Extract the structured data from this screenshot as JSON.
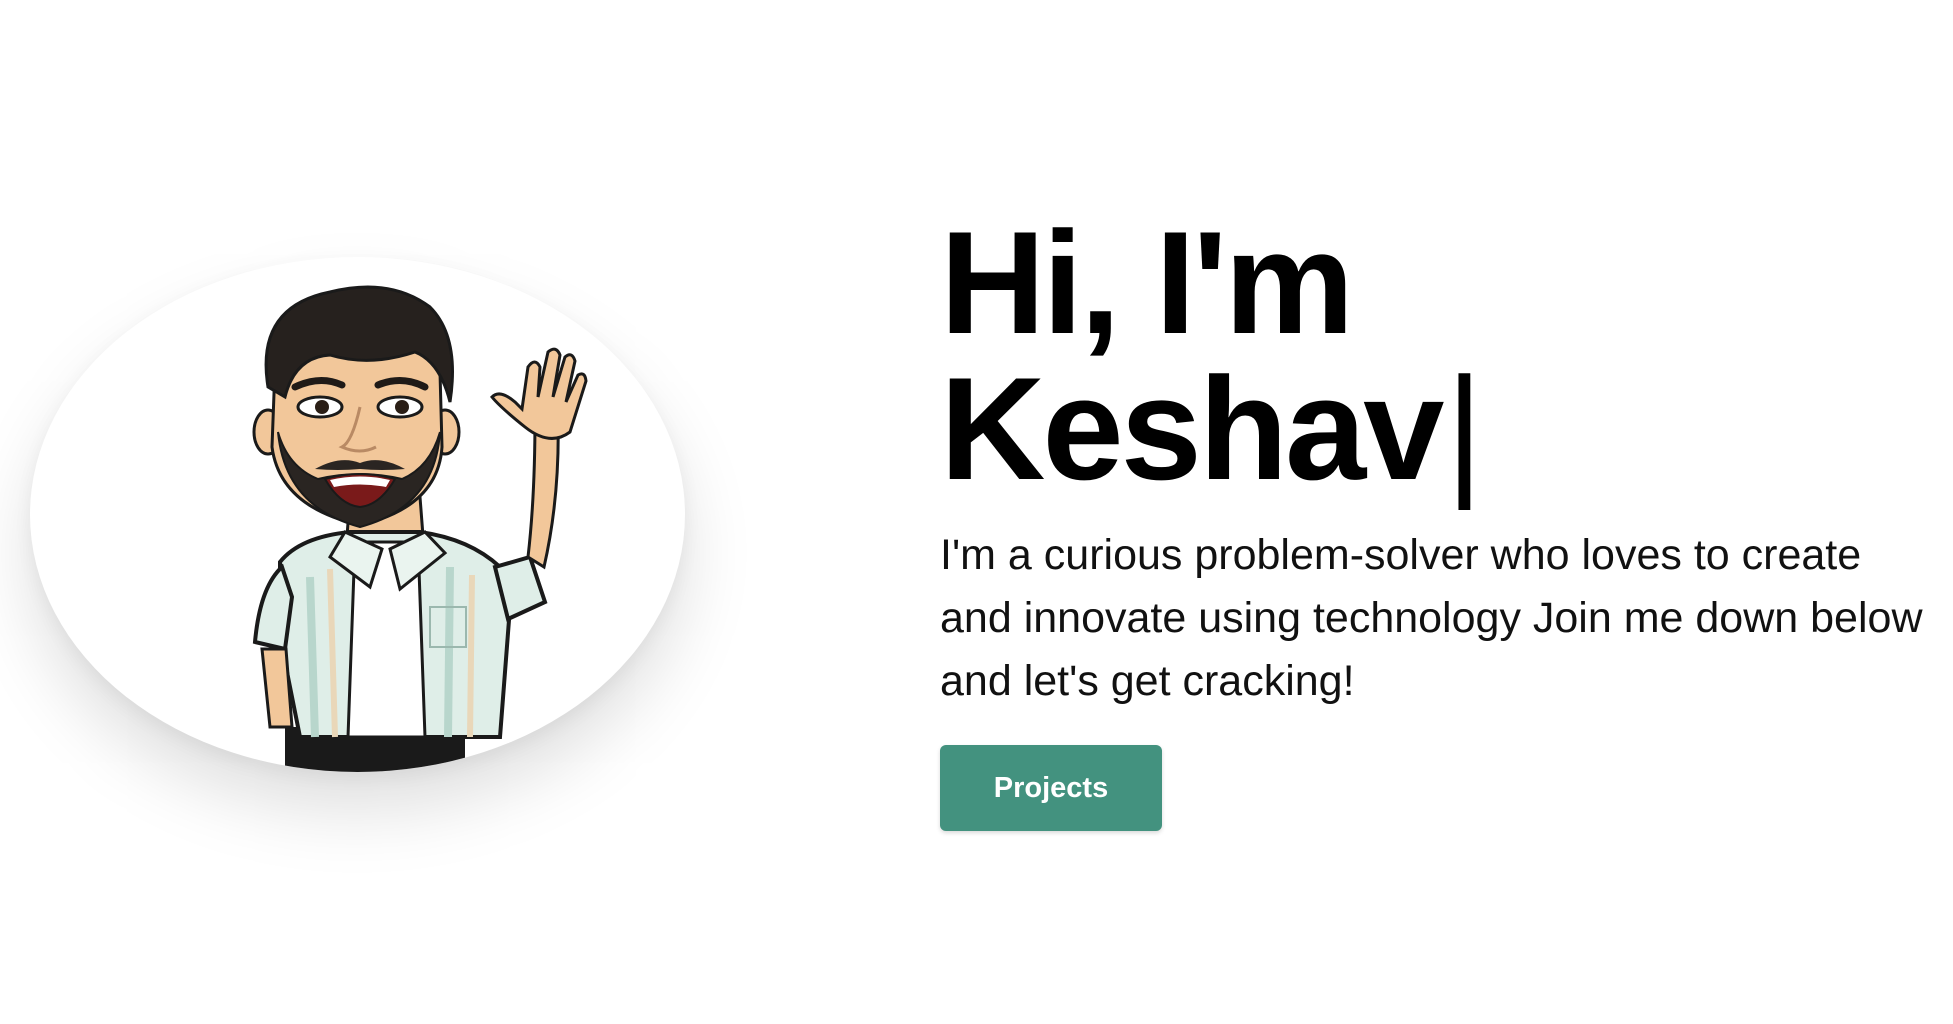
{
  "hero": {
    "greeting": "Hi, I'm",
    "name": "Keshav",
    "cursor": "|",
    "description": "I'm a curious problem-solver who loves to create and innovate using technology Join me down below and let's get cracking!",
    "projects_button": "Projects"
  },
  "avatar": {
    "icon": "waving-bitmoji-avatar"
  },
  "colors": {
    "accent": "#43927f",
    "text": "#000000",
    "background": "#ffffff"
  }
}
